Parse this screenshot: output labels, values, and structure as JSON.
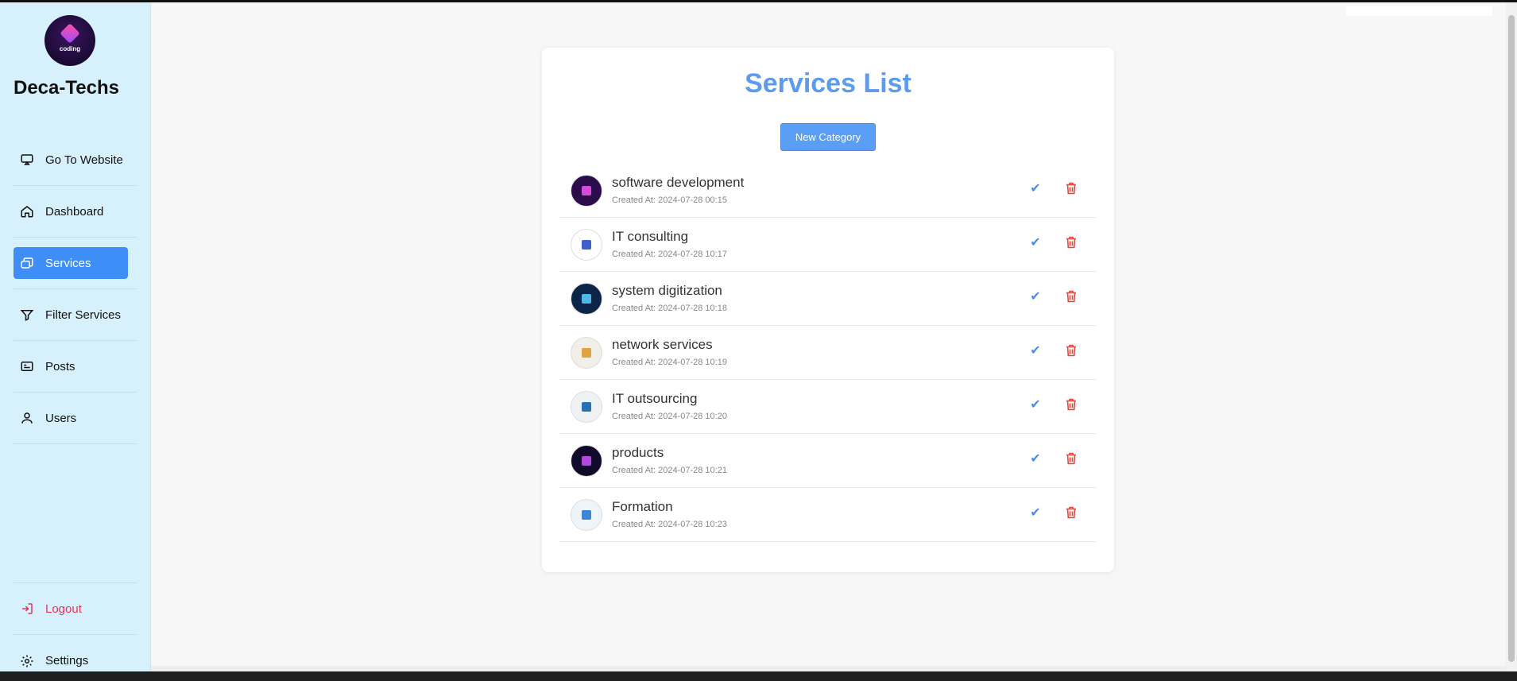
{
  "app": {
    "brand": "Deca-Techs",
    "logo_text": "coding"
  },
  "sidebar": {
    "items": [
      {
        "label": "Go To Website",
        "icon": "monitor-icon"
      },
      {
        "label": "Dashboard",
        "icon": "home-icon"
      },
      {
        "label": "Services",
        "icon": "services-icon",
        "active": true
      },
      {
        "label": "Filter Services",
        "icon": "filter-icon"
      },
      {
        "label": "Posts",
        "icon": "posts-icon"
      },
      {
        "label": "Users",
        "icon": "user-icon"
      }
    ],
    "logout_label": "Logout",
    "settings_label": "Settings"
  },
  "main": {
    "title": "Services List",
    "new_button_label": "New Category",
    "services": [
      {
        "name": "software development",
        "created": "Created At: 2024-07-28 00:15",
        "avatar_bg": "#2a0d4a",
        "avatar_mark": "#d44bd8"
      },
      {
        "name": "IT consulting",
        "created": "Created At: 2024-07-28 10:17",
        "avatar_bg": "#ffffff",
        "avatar_mark": "#3f5fcf"
      },
      {
        "name": "system digitization",
        "created": "Created At: 2024-07-28 10:18",
        "avatar_bg": "#0c2448",
        "avatar_mark": "#4fb7e8"
      },
      {
        "name": "network services",
        "created": "Created At: 2024-07-28 10:19",
        "avatar_bg": "#f1efe8",
        "avatar_mark": "#e0a340"
      },
      {
        "name": "IT outsourcing",
        "created": "Created At: 2024-07-28 10:20",
        "avatar_bg": "#eef2f5",
        "avatar_mark": "#2a6fb5"
      },
      {
        "name": "products",
        "created": "Created At: 2024-07-28 10:21",
        "avatar_bg": "#120a2a",
        "avatar_mark": "#b248e0"
      },
      {
        "name": "Formation",
        "created": "Created At: 2024-07-28 10:23",
        "avatar_bg": "#eef4f8",
        "avatar_mark": "#3d86d6"
      }
    ]
  },
  "colors": {
    "sidebar_bg": "#d6f1fb",
    "accent": "#3e8ef7",
    "title": "#5b9bf0",
    "delete": "#e24a3b",
    "logout": "#e2355a"
  }
}
